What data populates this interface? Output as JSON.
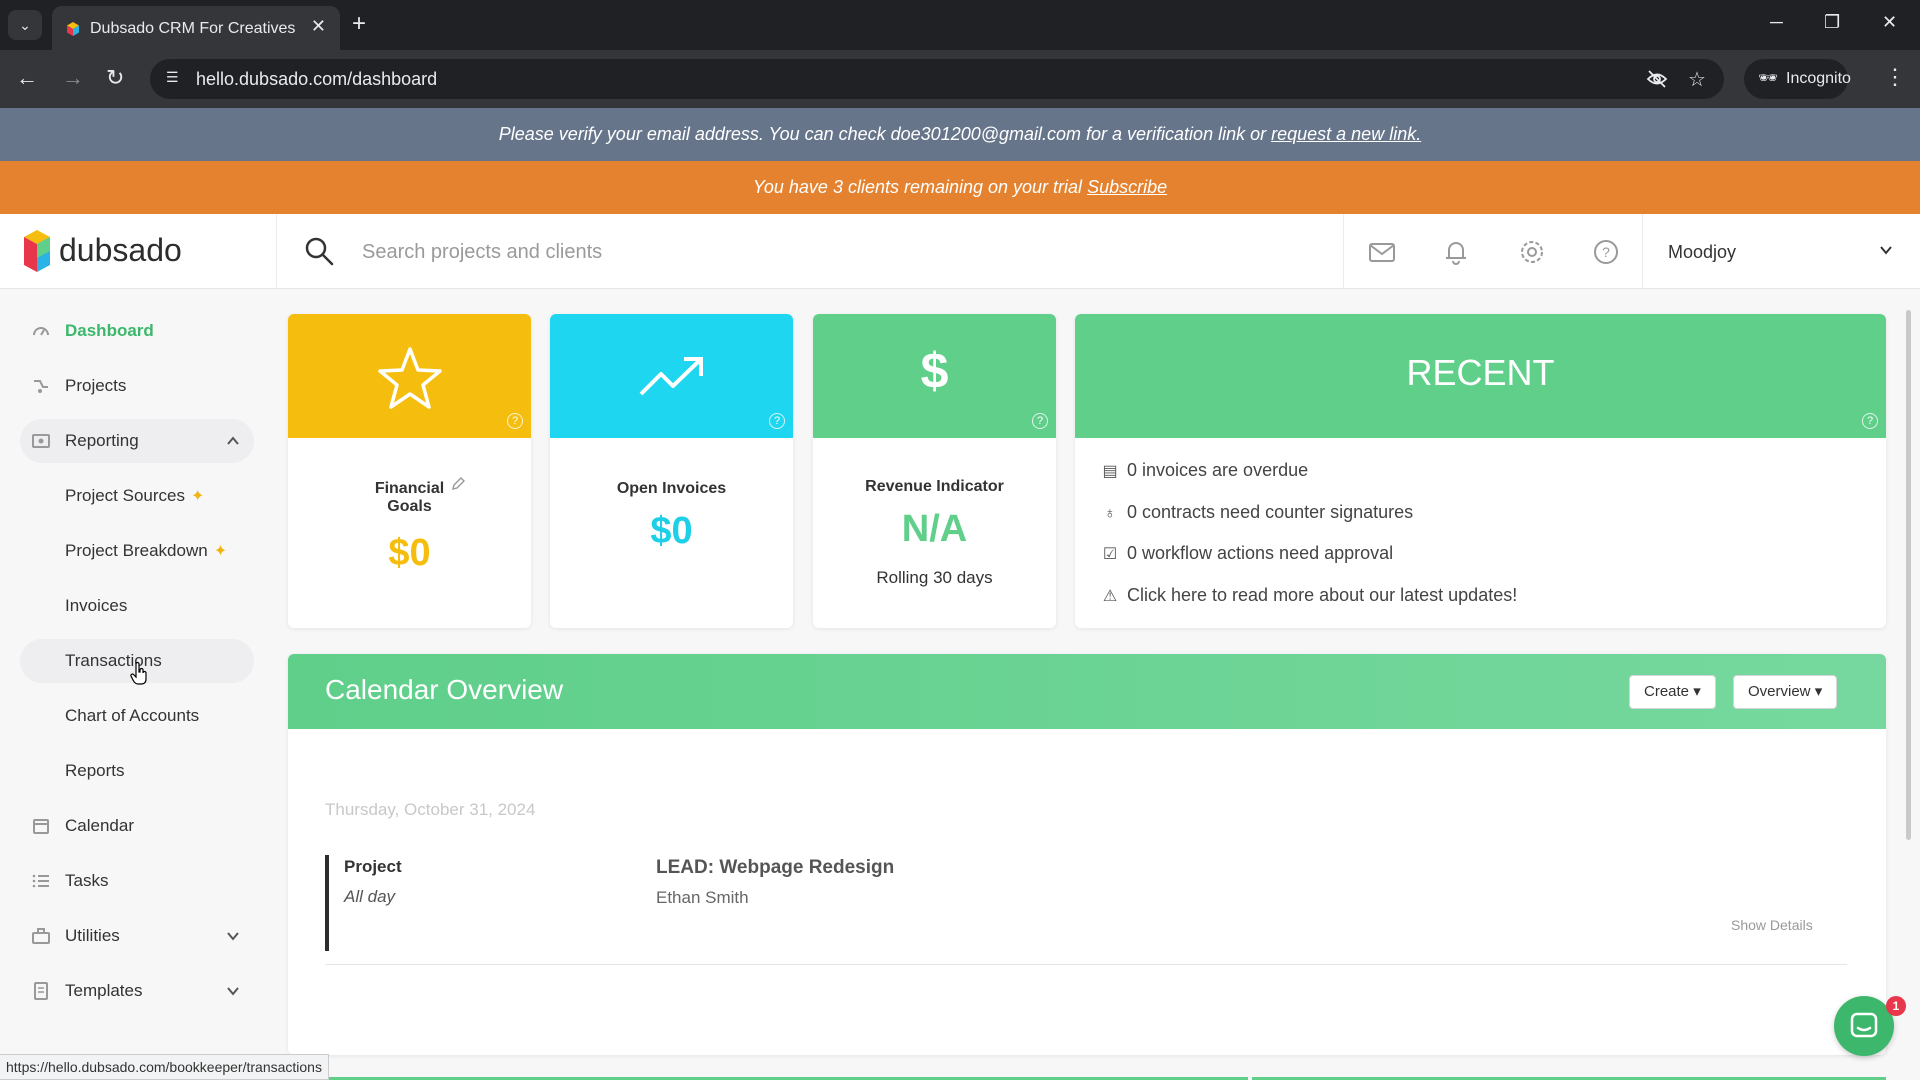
{
  "browser": {
    "tab_title": "Dubsado CRM For Creatives",
    "url": "hello.dubsado.com/dashboard",
    "incognito_label": "Incognito",
    "status_url": "https://hello.dubsado.com/bookkeeper/transactions"
  },
  "banners": {
    "verify_text": "Please verify your email address. You can check doe301200@gmail.com for a verification link or",
    "verify_link": "request a new link.",
    "trial_text": "You have 3 clients remaining on your trial",
    "trial_link": "Subscribe"
  },
  "header": {
    "logo_text": "dubsado",
    "search_placeholder": "Search projects and clients",
    "user_name": "Moodjoy"
  },
  "sidebar": {
    "items": [
      {
        "label": "Dashboard",
        "icon": "dashboard-icon",
        "active": true
      },
      {
        "label": "Projects",
        "icon": "projects-icon"
      },
      {
        "label": "Reporting",
        "icon": "reporting-icon",
        "expanded": true
      },
      {
        "label": "Project Sources",
        "icon": "sparkle-icon"
      },
      {
        "label": "Project Breakdown",
        "icon": "sparkle-icon"
      },
      {
        "label": "Invoices"
      },
      {
        "label": "Transactions",
        "hovered": true
      },
      {
        "label": "Chart of Accounts"
      },
      {
        "label": "Reports"
      },
      {
        "label": "Calendar",
        "icon": "calendar-icon"
      },
      {
        "label": "Tasks",
        "icon": "tasks-icon"
      },
      {
        "label": "Utilities",
        "icon": "utilities-icon"
      },
      {
        "label": "Templates",
        "icon": "templates-icon"
      }
    ]
  },
  "widgets": {
    "financial_goals": {
      "label_line1": "Financial",
      "label_line2": "Goals",
      "value": "$0",
      "icon": "star-icon"
    },
    "open_invoices": {
      "label": "Open Invoices",
      "value": "$0",
      "icon": "trend-up-icon"
    },
    "revenue": {
      "label": "Revenue Indicator",
      "value": "N/A",
      "sub": "Rolling 30 days",
      "icon": "dollar-icon"
    },
    "recent": {
      "title": "RECENT",
      "items": [
        {
          "text": "0 invoices are overdue",
          "icon": "invoice-icon"
        },
        {
          "text": "0 contracts need counter signatures",
          "icon": "contract-icon"
        },
        {
          "text": "0 workflow actions need approval",
          "icon": "checkbox-icon"
        },
        {
          "text": "Click here to read more about our latest updates!",
          "icon": "warning-icon"
        }
      ]
    }
  },
  "calendar": {
    "title": "Calendar Overview",
    "create_label": "Create",
    "overview_label": "Overview",
    "date": "Thursday, October 31, 2024",
    "event": {
      "type": "Project",
      "time": "All day",
      "name": "LEAD: Webpage Redesign",
      "client": "Ethan Smith",
      "details_label": "Show Details"
    }
  },
  "chat": {
    "badge": "1"
  },
  "colors": {
    "green": "#5fcf8a",
    "yellow": "#f5be0f",
    "cyan": "#1ed6f0",
    "orange": "#e4822f",
    "slate": "#67758b",
    "dashboard_active": "#3db76b"
  }
}
